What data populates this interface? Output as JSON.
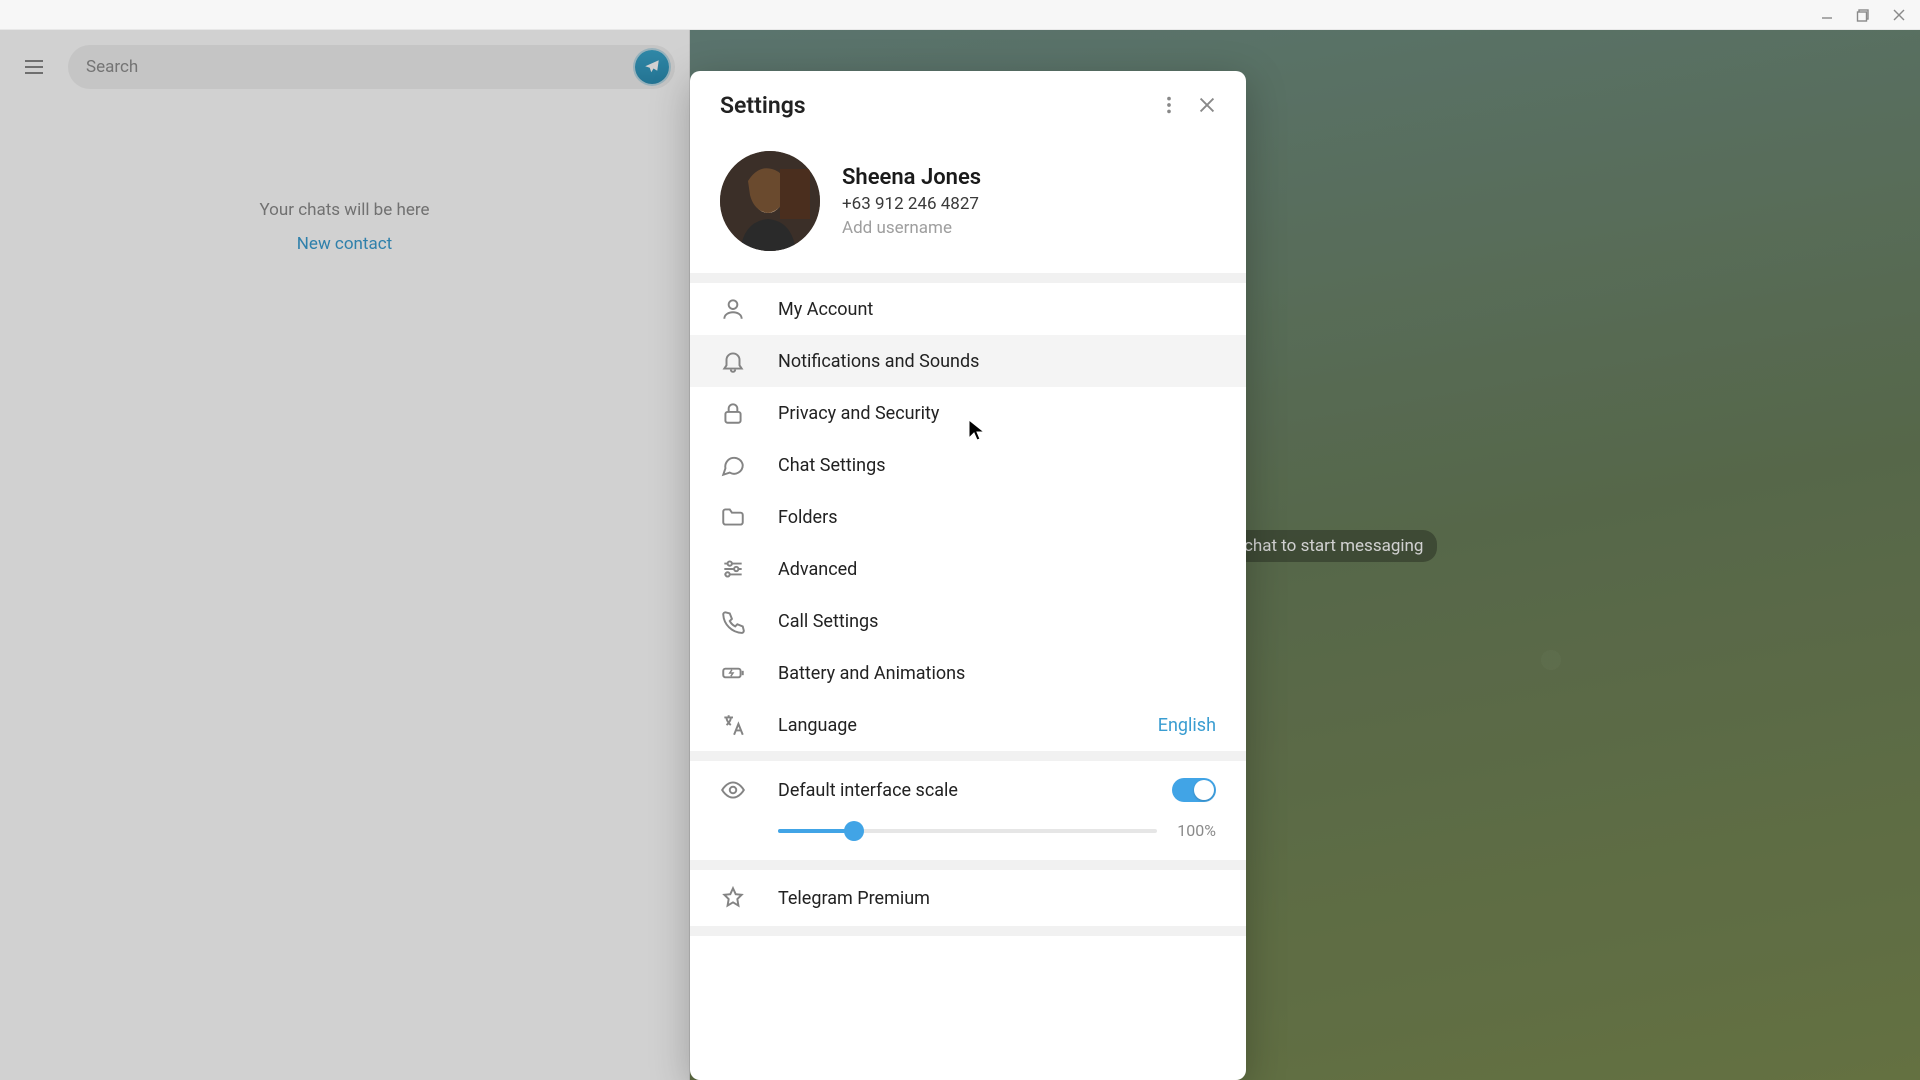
{
  "search": {
    "placeholder": "Search"
  },
  "sidebar": {
    "empty_text": "Your chats will be here",
    "new_contact": "New contact"
  },
  "main": {
    "start_messaging": "chat to start messaging"
  },
  "settings": {
    "title": "Settings",
    "profile": {
      "name": "Sheena Jones",
      "phone": "+63 912 246 4827",
      "add_username": "Add username"
    },
    "items": [
      {
        "label": "My Account"
      },
      {
        "label": "Notifications and Sounds"
      },
      {
        "label": "Privacy and Security"
      },
      {
        "label": "Chat Settings"
      },
      {
        "label": "Folders"
      },
      {
        "label": "Advanced"
      },
      {
        "label": "Call Settings"
      },
      {
        "label": "Battery and Animations"
      },
      {
        "label": "Language",
        "value": "English"
      }
    ],
    "scale": {
      "label": "Default interface scale",
      "value": "100%"
    },
    "premium": {
      "label": "Telegram Premium"
    }
  }
}
